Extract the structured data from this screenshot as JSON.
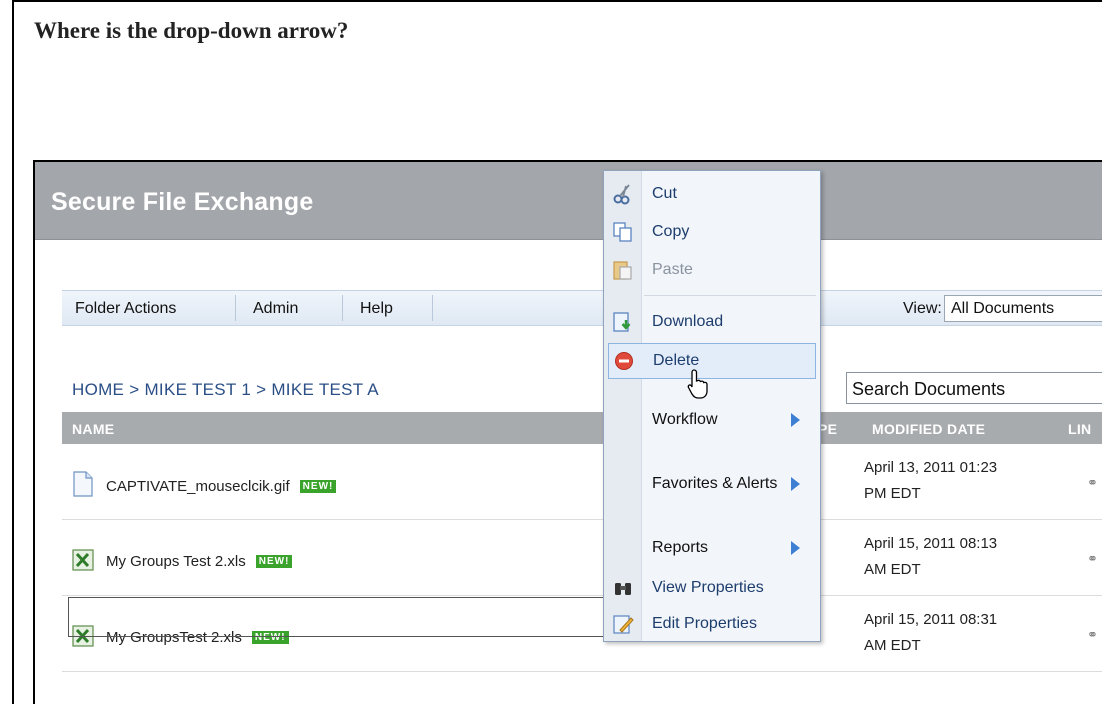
{
  "question": "Where is the drop-down arrow?",
  "app": {
    "title": "Secure File Exchange"
  },
  "menubar": {
    "items": [
      "Folder Actions",
      "Admin",
      "Help"
    ],
    "view_label": "View:",
    "view_value": "All Documents"
  },
  "breadcrumb": {
    "text": "HOME  >  MIKE TEST 1  >  MIKE TEST A"
  },
  "search": {
    "value": "Search Documents"
  },
  "table": {
    "columns": [
      "NAME",
      "PE",
      "MODIFIED DATE",
      "LIN"
    ],
    "rows": [
      {
        "name": "CAPTIVATE_mouseclcik.gif",
        "badge": "NEW!",
        "date_line1": "April 13, 2011 01:23",
        "date_line2": "PM EDT",
        "icon": "document-icon"
      },
      {
        "name": "My Groups Test 2.xls",
        "badge": "NEW!",
        "date_line1": "April 15, 2011 08:13",
        "date_line2": "AM EDT",
        "icon": "excel-icon"
      },
      {
        "name": "My GroupsTest 2.xls",
        "badge": "NEW!",
        "date_line1": "April 15, 2011 08:31",
        "date_line2": "AM EDT",
        "icon": "excel-icon"
      }
    ]
  },
  "context_menu": {
    "items": [
      {
        "label": "Cut",
        "icon": "scissors-icon"
      },
      {
        "label": "Copy",
        "icon": "copy-icon"
      },
      {
        "label": "Paste",
        "icon": "paste-icon",
        "disabled": true
      },
      {
        "label": "Download",
        "icon": "download-icon"
      },
      {
        "label": "Delete",
        "icon": "delete-icon",
        "highlighted": true
      },
      {
        "label": "Workflow",
        "submenu": true
      },
      {
        "label": "Favorites & Alerts",
        "submenu": true
      },
      {
        "label": "Reports",
        "submenu": true
      },
      {
        "label": "View Properties",
        "icon": "binoculars-icon"
      },
      {
        "label": "Edit Properties",
        "icon": "pencil-icon"
      }
    ]
  },
  "colors": {
    "header_bg": "#a3a6ab",
    "menubar_bg": "#dfe8f3",
    "new_badge": "#3aa32b",
    "link_blue": "#2a4e86",
    "submenu_arrow": "#3d7fd2"
  }
}
